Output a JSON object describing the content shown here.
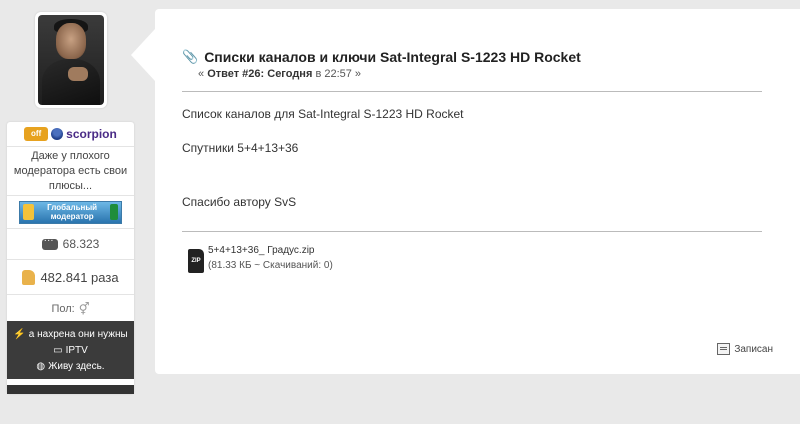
{
  "user": {
    "badge": "off",
    "name": "scorpion",
    "status": "Даже у плохого модератора есть свои плюсы...",
    "rank": "Глобальный модератор",
    "posts": "68.323",
    "likes": "482.841 раза",
    "gender_label": "Пол:",
    "links": [
      "а нахрена они нужны",
      "IPTV",
      "Живу здесь."
    ]
  },
  "post": {
    "title": "Списки каналов и ключи Sat-Integral S-1223 HD Rocket",
    "meta_prefix": "«",
    "meta_reply": "Ответ #26:",
    "meta_day": "Сегодня",
    "meta_time": "в 22:57 »",
    "body": [
      "Список каналов для Sat-Integral S-1223 HD Rocket",
      "Спутники 5+4+13+36",
      "Спасибо автору  SvS"
    ],
    "attachment": {
      "icon_text": "ZIP",
      "name": "5+4+13+36_ Градус.zip",
      "info": "(81.33 КБ ~ Скачиваний: 0)"
    },
    "report_label": "Записан"
  },
  "icons": {
    "attach": "paperclip-icon",
    "posts": "message-icon",
    "likes": "thumbs-up-icon",
    "gender": "gender-icon",
    "report": "report-icon"
  }
}
